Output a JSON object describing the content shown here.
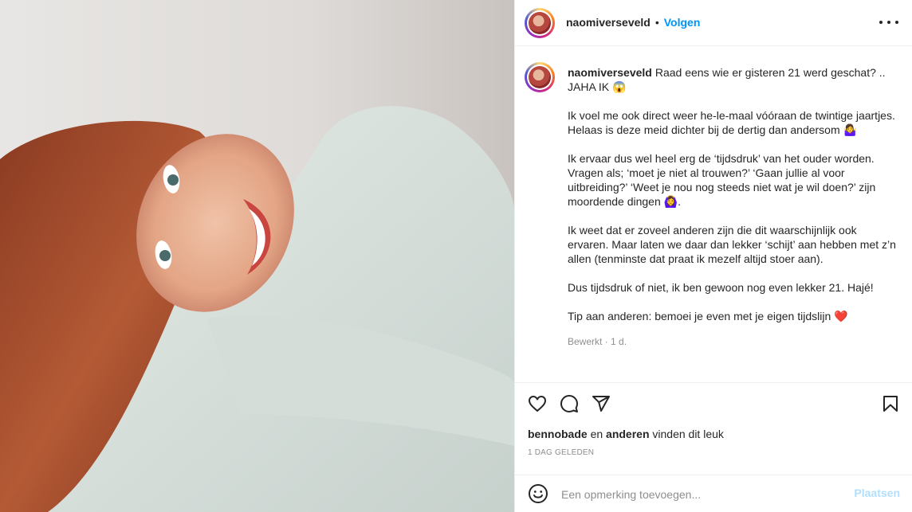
{
  "post": {
    "username": "naomiverseveld",
    "separator": "•",
    "follow_label": "Volgen",
    "more_icon": "more-horizontal-icon",
    "photo_description_icon": "photo"
  },
  "caption": {
    "username": "naomiverseveld",
    "paragraphs": [
      "Raad eens wie er gisteren 21 werd geschat? .. JAHA IK 😱",
      "Ik voel me ook direct weer he-le-maal vóóraan de twintige jaartjes. Helaas is deze meid dichter bij de dertig dan andersom 🤷‍♀️",
      "Ik ervaar dus wel heel erg de ‘tijdsdruk’ van het ouder worden. Vragen als; ‘moet je niet al trouwen?’ ‘Gaan jullie al voor uitbreiding?’ ‘Weet je nou nog steeds niet wat je wil doen?’ zijn moordende dingen 🙆‍♀️.",
      "Ik weet dat er zoveel anderen zijn die dit waarschijnlijk ook ervaren. Maar laten we daar dan lekker ‘schijt’ aan hebben met z’n allen (tenminste dat praat ik mezelf altijd stoer aan).",
      "Dus tijdsdruk of niet, ik ben gewoon nog even lekker 21. Hajé!",
      "Tip aan anderen: bemoei je even met je eigen tijdslijn ❤️"
    ],
    "meta": "Bewerkt · 1 d."
  },
  "actions": {
    "like_icon": "heart-icon",
    "comment_icon": "comment-icon",
    "share_icon": "share-icon",
    "save_icon": "bookmark-icon"
  },
  "likes": {
    "user": "bennobade",
    "connector": "en",
    "others": "anderen",
    "suffix": "vinden dit leuk"
  },
  "date": "1 DAG GELEDEN",
  "comment": {
    "emoji_icon": "smiley-icon",
    "placeholder": "Een opmerking toevoegen...",
    "post_label": "Plaatsen"
  },
  "colors": {
    "accent": "#0095f6",
    "post_disabled": "#b2dffc",
    "text": "#262626",
    "muted": "#8e8e8e",
    "heart_emoji": "#e0245e"
  }
}
